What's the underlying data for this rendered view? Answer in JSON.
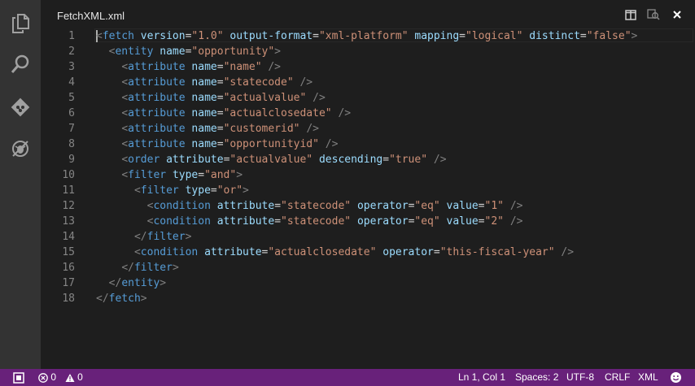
{
  "tab": {
    "title": "FetchXML.xml"
  },
  "activity_bar": {
    "icons": [
      "files-icon",
      "search-icon",
      "git-icon",
      "debug-icon"
    ]
  },
  "title_actions": [
    "split-editor-icon",
    "open-changes-icon",
    "close-icon"
  ],
  "editor": {
    "language": "XML",
    "lines": [
      {
        "num": "1",
        "indent": 0,
        "tokens": [
          [
            "punc",
            "<"
          ],
          [
            "tag",
            "fetch"
          ],
          [
            "sp",
            " "
          ],
          [
            "attr",
            "version"
          ],
          [
            "eq",
            "="
          ],
          [
            "val",
            "\"1.0\""
          ],
          [
            "sp",
            " "
          ],
          [
            "attr",
            "output-format"
          ],
          [
            "eq",
            "="
          ],
          [
            "val",
            "\"xml-platform\""
          ],
          [
            "sp",
            " "
          ],
          [
            "attr",
            "mapping"
          ],
          [
            "eq",
            "="
          ],
          [
            "val",
            "\"logical\""
          ],
          [
            "sp",
            " "
          ],
          [
            "attr",
            "distinct"
          ],
          [
            "eq",
            "="
          ],
          [
            "val",
            "\"false\""
          ],
          [
            "punc",
            ">"
          ]
        ]
      },
      {
        "num": "2",
        "indent": 2,
        "tokens": [
          [
            "punc",
            "<"
          ],
          [
            "tag",
            "entity"
          ],
          [
            "sp",
            " "
          ],
          [
            "attr",
            "name"
          ],
          [
            "eq",
            "="
          ],
          [
            "val",
            "\"opportunity\""
          ],
          [
            "punc",
            ">"
          ]
        ]
      },
      {
        "num": "3",
        "indent": 4,
        "tokens": [
          [
            "punc",
            "<"
          ],
          [
            "tag",
            "attribute"
          ],
          [
            "sp",
            " "
          ],
          [
            "attr",
            "name"
          ],
          [
            "eq",
            "="
          ],
          [
            "val",
            "\"name\""
          ],
          [
            "sp",
            " "
          ],
          [
            "punc",
            "/>"
          ]
        ]
      },
      {
        "num": "4",
        "indent": 4,
        "tokens": [
          [
            "punc",
            "<"
          ],
          [
            "tag",
            "attribute"
          ],
          [
            "sp",
            " "
          ],
          [
            "attr",
            "name"
          ],
          [
            "eq",
            "="
          ],
          [
            "val",
            "\"statecode\""
          ],
          [
            "sp",
            " "
          ],
          [
            "punc",
            "/>"
          ]
        ]
      },
      {
        "num": "5",
        "indent": 4,
        "tokens": [
          [
            "punc",
            "<"
          ],
          [
            "tag",
            "attribute"
          ],
          [
            "sp",
            " "
          ],
          [
            "attr",
            "name"
          ],
          [
            "eq",
            "="
          ],
          [
            "val",
            "\"actualvalue\""
          ],
          [
            "sp",
            " "
          ],
          [
            "punc",
            "/>"
          ]
        ]
      },
      {
        "num": "6",
        "indent": 4,
        "tokens": [
          [
            "punc",
            "<"
          ],
          [
            "tag",
            "attribute"
          ],
          [
            "sp",
            " "
          ],
          [
            "attr",
            "name"
          ],
          [
            "eq",
            "="
          ],
          [
            "val",
            "\"actualclosedate\""
          ],
          [
            "sp",
            " "
          ],
          [
            "punc",
            "/>"
          ]
        ]
      },
      {
        "num": "7",
        "indent": 4,
        "tokens": [
          [
            "punc",
            "<"
          ],
          [
            "tag",
            "attribute"
          ],
          [
            "sp",
            " "
          ],
          [
            "attr",
            "name"
          ],
          [
            "eq",
            "="
          ],
          [
            "val",
            "\"customerid\""
          ],
          [
            "sp",
            " "
          ],
          [
            "punc",
            "/>"
          ]
        ]
      },
      {
        "num": "8",
        "indent": 4,
        "tokens": [
          [
            "punc",
            "<"
          ],
          [
            "tag",
            "attribute"
          ],
          [
            "sp",
            " "
          ],
          [
            "attr",
            "name"
          ],
          [
            "eq",
            "="
          ],
          [
            "val",
            "\"opportunityid\""
          ],
          [
            "sp",
            " "
          ],
          [
            "punc",
            "/>"
          ]
        ]
      },
      {
        "num": "9",
        "indent": 4,
        "tokens": [
          [
            "punc",
            "<"
          ],
          [
            "tag",
            "order"
          ],
          [
            "sp",
            " "
          ],
          [
            "attr",
            "attribute"
          ],
          [
            "eq",
            "="
          ],
          [
            "val",
            "\"actualvalue\""
          ],
          [
            "sp",
            " "
          ],
          [
            "attr",
            "descending"
          ],
          [
            "eq",
            "="
          ],
          [
            "val",
            "\"true\""
          ],
          [
            "sp",
            " "
          ],
          [
            "punc",
            "/>"
          ]
        ]
      },
      {
        "num": "10",
        "indent": 4,
        "tokens": [
          [
            "punc",
            "<"
          ],
          [
            "tag",
            "filter"
          ],
          [
            "sp",
            " "
          ],
          [
            "attr",
            "type"
          ],
          [
            "eq",
            "="
          ],
          [
            "val",
            "\"and\""
          ],
          [
            "punc",
            ">"
          ]
        ]
      },
      {
        "num": "11",
        "indent": 6,
        "tokens": [
          [
            "punc",
            "<"
          ],
          [
            "tag",
            "filter"
          ],
          [
            "sp",
            " "
          ],
          [
            "attr",
            "type"
          ],
          [
            "eq",
            "="
          ],
          [
            "val",
            "\"or\""
          ],
          [
            "punc",
            ">"
          ]
        ]
      },
      {
        "num": "12",
        "indent": 8,
        "tokens": [
          [
            "punc",
            "<"
          ],
          [
            "tag",
            "condition"
          ],
          [
            "sp",
            " "
          ],
          [
            "attr",
            "attribute"
          ],
          [
            "eq",
            "="
          ],
          [
            "val",
            "\"statecode\""
          ],
          [
            "sp",
            " "
          ],
          [
            "attr",
            "operator"
          ],
          [
            "eq",
            "="
          ],
          [
            "val",
            "\"eq\""
          ],
          [
            "sp",
            " "
          ],
          [
            "attr",
            "value"
          ],
          [
            "eq",
            "="
          ],
          [
            "val",
            "\"1\""
          ],
          [
            "sp",
            " "
          ],
          [
            "punc",
            "/>"
          ]
        ]
      },
      {
        "num": "13",
        "indent": 8,
        "tokens": [
          [
            "punc",
            "<"
          ],
          [
            "tag",
            "condition"
          ],
          [
            "sp",
            " "
          ],
          [
            "attr",
            "attribute"
          ],
          [
            "eq",
            "="
          ],
          [
            "val",
            "\"statecode\""
          ],
          [
            "sp",
            " "
          ],
          [
            "attr",
            "operator"
          ],
          [
            "eq",
            "="
          ],
          [
            "val",
            "\"eq\""
          ],
          [
            "sp",
            " "
          ],
          [
            "attr",
            "value"
          ],
          [
            "eq",
            "="
          ],
          [
            "val",
            "\"2\""
          ],
          [
            "sp",
            " "
          ],
          [
            "punc",
            "/>"
          ]
        ]
      },
      {
        "num": "14",
        "indent": 6,
        "tokens": [
          [
            "punc",
            "</"
          ],
          [
            "tag",
            "filter"
          ],
          [
            "punc",
            ">"
          ]
        ]
      },
      {
        "num": "15",
        "indent": 6,
        "tokens": [
          [
            "punc",
            "<"
          ],
          [
            "tag",
            "condition"
          ],
          [
            "sp",
            " "
          ],
          [
            "attr",
            "attribute"
          ],
          [
            "eq",
            "="
          ],
          [
            "val",
            "\"actualclosedate\""
          ],
          [
            "sp",
            " "
          ],
          [
            "attr",
            "operator"
          ],
          [
            "eq",
            "="
          ],
          [
            "val",
            "\"this-fiscal-year\""
          ],
          [
            "sp",
            " "
          ],
          [
            "punc",
            "/>"
          ]
        ]
      },
      {
        "num": "16",
        "indent": 4,
        "tokens": [
          [
            "punc",
            "</"
          ],
          [
            "tag",
            "filter"
          ],
          [
            "punc",
            ">"
          ]
        ]
      },
      {
        "num": "17",
        "indent": 2,
        "tokens": [
          [
            "punc",
            "</"
          ],
          [
            "tag",
            "entity"
          ],
          [
            "punc",
            ">"
          ]
        ]
      },
      {
        "num": "18",
        "indent": 0,
        "tokens": [
          [
            "punc",
            "</"
          ],
          [
            "tag",
            "fetch"
          ],
          [
            "punc",
            ">"
          ]
        ]
      }
    ]
  },
  "status_bar": {
    "errors": "0",
    "warnings": "0",
    "position": "Ln 1, Col 1",
    "indent": "Spaces: 2",
    "encoding": "UTF-8",
    "eol": "CRLF",
    "language": "XML"
  },
  "colors": {
    "status_bar_bg": "#68217a",
    "editor_bg": "#1e1e1e",
    "activity_bar_bg": "#333333",
    "tag": "#569cd6",
    "attribute": "#9cdcfe",
    "string": "#ce9178",
    "punctuation": "#808080"
  }
}
